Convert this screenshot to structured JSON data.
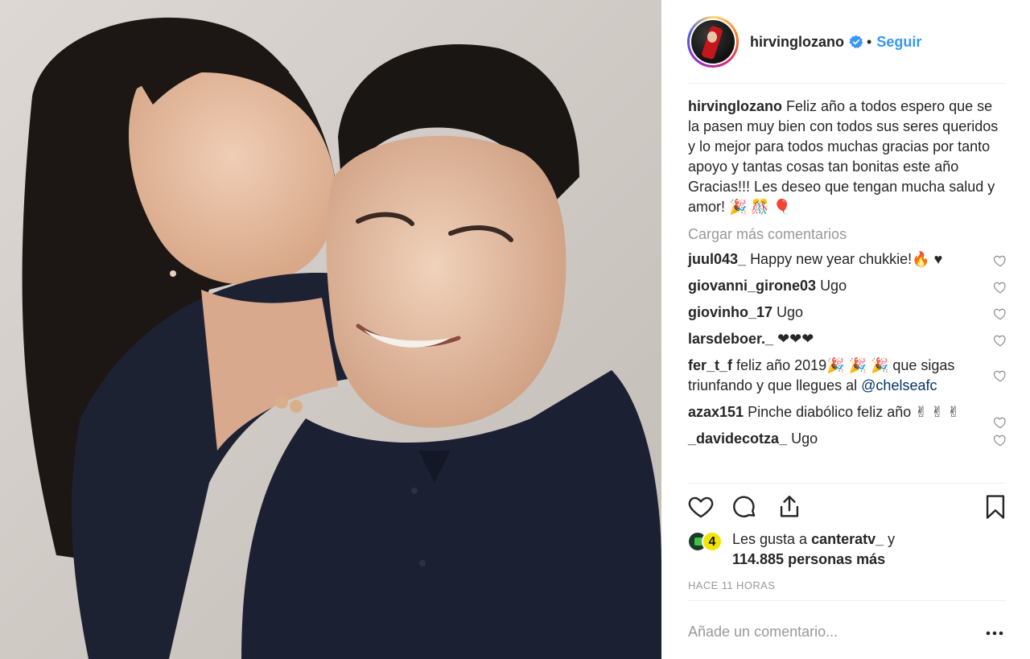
{
  "post": {
    "image_icon": "photo-selfie",
    "author": {
      "username": "hirvinglozano",
      "verified_icon": "verified-badge-icon",
      "follow_label": "Seguir",
      "separator": "•"
    },
    "caption": {
      "username": "hirvinglozano",
      "text": "Feliz año a todos espero que se la pasen muy bien con todos sus seres queridos y lo mejor para todos muchas gracias por tanto apoyo y tantas cosas tan bonitas este año Gracias!!! Les deseo que tengan mucha salud y amor! 🎉 🎊 🎈"
    },
    "load_more_label": "Cargar más comentarios",
    "comments": [
      {
        "username": "juul043_",
        "text": "Happy new year chukkie!🔥 ♥"
      },
      {
        "username": "giovanni_girone03",
        "text": "Ugo"
      },
      {
        "username": "giovinho_17",
        "text": "Ugo"
      },
      {
        "username": "larsdeboer._",
        "text": "❤❤❤"
      },
      {
        "username": "fer_t_f",
        "text": "feliz año 2019🎉 🎉 🎉  que sigas triunfando y que llegues al ",
        "mention": "@chelseafc"
      },
      {
        "username": "azax151",
        "text": "Pinche diabólico feliz año ✌ ✌ ✌"
      },
      {
        "username": "_davidecotza_",
        "text": "Ugo"
      }
    ],
    "actions": {
      "like_icon": "heart-outline-icon",
      "comment_icon": "comment-bubble-icon",
      "share_icon": "share-upload-icon",
      "save_icon": "bookmark-icon"
    },
    "likes": {
      "prefix": "Les gusta a ",
      "liker": "canteratv_",
      "suffix": " y",
      "count_text": "114.885 personas más",
      "avatar2_label": "4"
    },
    "timestamp": "HACE 11 HORAS",
    "add_comment_placeholder": "Añade un comentario...",
    "more_icon": "more-dots-icon"
  },
  "colors": {
    "link": "#3897f0",
    "text": "#262626",
    "muted": "#999999",
    "divider": "#efefef"
  }
}
